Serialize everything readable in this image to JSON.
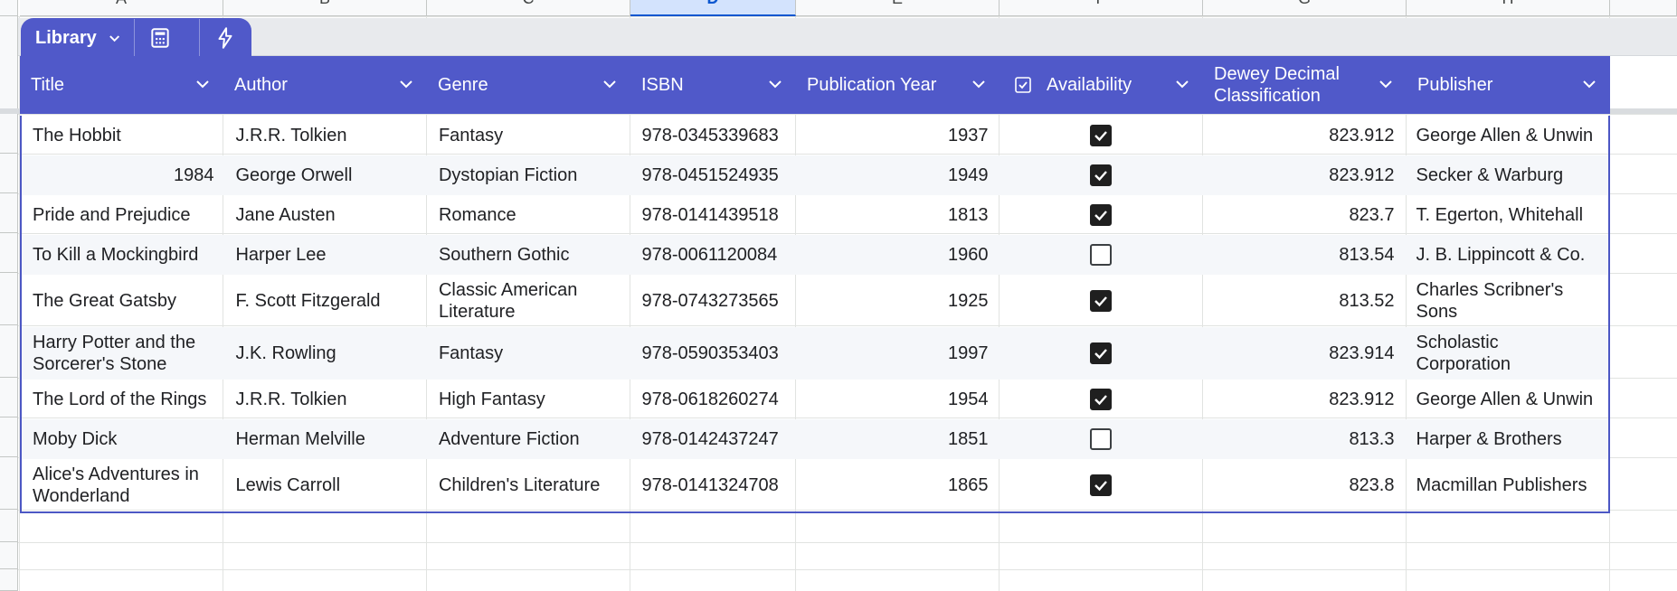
{
  "sheet": {
    "columns": [
      "A",
      "B",
      "C",
      "D",
      "E",
      "F",
      "G",
      "H"
    ],
    "selected_column": "D"
  },
  "table": {
    "name": "Library",
    "dropdown_icon": "chevron-down-icon",
    "tools": [
      {
        "name": "calculator-icon"
      },
      {
        "name": "lightning-icon"
      }
    ],
    "headers": [
      {
        "label": "Title"
      },
      {
        "label": "Author"
      },
      {
        "label": "Genre"
      },
      {
        "label": "ISBN"
      },
      {
        "label": "Publication Year"
      },
      {
        "label": "Availability",
        "icon": "checkbox-icon"
      },
      {
        "label": "Dewey Decimal Classification"
      },
      {
        "label": "Publisher"
      }
    ],
    "rows": [
      {
        "title": "The Hobbit",
        "author": "J.R.R. Tolkien",
        "genre": "Fantasy",
        "isbn": "978-0345339683",
        "year": "1937",
        "available": true,
        "dewey": "823.912",
        "publisher": "George Allen & Unwin"
      },
      {
        "title": "1984",
        "author": "George Orwell",
        "genre": "Dystopian Fiction",
        "isbn": "978-0451524935",
        "year": "1949",
        "available": true,
        "dewey": "823.912",
        "publisher": "Secker & Warburg"
      },
      {
        "title": "Pride and Prejudice",
        "author": "Jane Austen",
        "genre": "Romance",
        "isbn": "978-0141439518",
        "year": "1813",
        "available": true,
        "dewey": "823.7",
        "publisher": "T. Egerton, Whitehall"
      },
      {
        "title": "To Kill a Mockingbird",
        "author": "Harper Lee",
        "genre": "Southern Gothic",
        "isbn": "978-0061120084",
        "year": "1960",
        "available": false,
        "dewey": "813.54",
        "publisher": "J. B. Lippincott & Co."
      },
      {
        "title": "The Great Gatsby",
        "author": "F. Scott Fitzgerald",
        "genre": "Classic American Literature",
        "isbn": "978-0743273565",
        "year": "1925",
        "available": true,
        "dewey": "813.52",
        "publisher": "Charles Scribner's Sons"
      },
      {
        "title": "Harry Potter and the Sorcerer's Stone",
        "author": "J.K. Rowling",
        "genre": "Fantasy",
        "isbn": "978-0590353403",
        "year": "1997",
        "available": true,
        "dewey": "823.914",
        "publisher": "Scholastic Corporation"
      },
      {
        "title": "The Lord of the Rings",
        "author": "J.R.R. Tolkien",
        "genre": "High Fantasy",
        "isbn": "978-0618260274",
        "year": "1954",
        "available": true,
        "dewey": "823.912",
        "publisher": "George Allen & Unwin"
      },
      {
        "title": "Moby Dick",
        "author": "Herman Melville",
        "genre": "Adventure Fiction",
        "isbn": "978-0142437247",
        "year": "1851",
        "available": false,
        "dewey": "813.3",
        "publisher": "Harper & Brothers"
      },
      {
        "title": "Alice's Adventures in Wonderland",
        "author": "Lewis Carroll",
        "genre": "Children's Literature",
        "isbn": "978-0141324708",
        "year": "1865",
        "available": true,
        "dewey": "823.8",
        "publisher": "Macmillan Publishers"
      }
    ]
  },
  "colors": {
    "table_header": "#5059c9",
    "table_border": "#4c57c4",
    "selected_column": "#d3e3fd"
  }
}
